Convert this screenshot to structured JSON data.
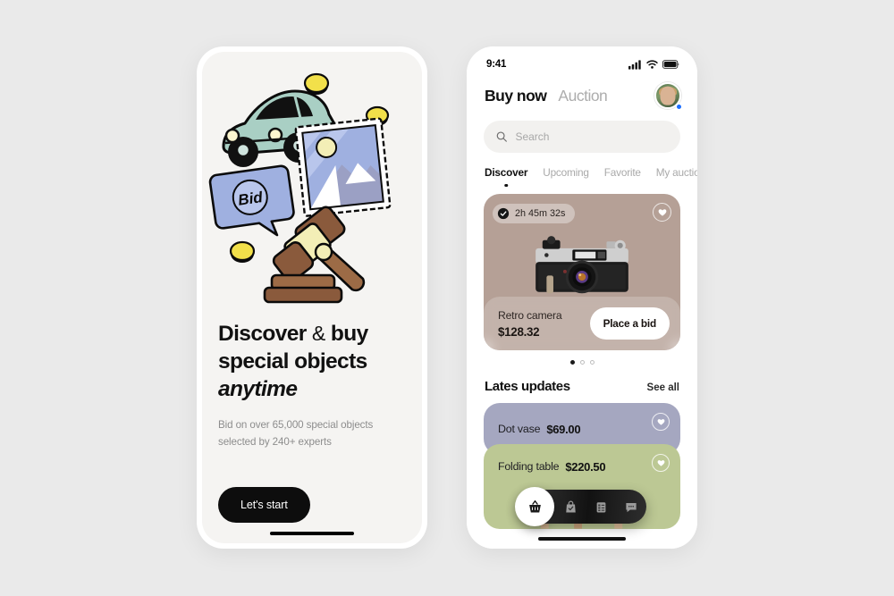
{
  "canvas": {
    "background": "#eaeaea"
  },
  "onboarding": {
    "title_line1_a": "Discover",
    "title_amp": "&",
    "title_line1_b": "buy",
    "title_line2": "special objects",
    "title_line3_italic": "anytime",
    "subtitle": "Bid on over 65,000 special objects selected by 240+ experts",
    "cta_label": "Let's start",
    "illustration_items": [
      "vintage-car",
      "gold-coin",
      "bid-speech-bubble",
      "postage-stamp",
      "auction-gavel"
    ]
  },
  "app": {
    "statusbar": {
      "time": "9:41",
      "icons": [
        "cellular-signal-icon",
        "wifi-icon",
        "battery-icon"
      ]
    },
    "header": {
      "tab_active": "Buy now",
      "tab_inactive": "Auction",
      "avatar_name": "user-avatar",
      "status_dot_color": "#1a6dff"
    },
    "search": {
      "placeholder": "Search",
      "value": "",
      "icon": "search-icon"
    },
    "chips": [
      {
        "label": "Discover",
        "active": true
      },
      {
        "label": "Upcoming",
        "active": false
      },
      {
        "label": "Favorite",
        "active": false
      },
      {
        "label": "My auction",
        "active": false
      }
    ],
    "featured": {
      "timer": "2h 45m 32s",
      "timer_icon": "clock-icon",
      "favorite_icon": "heart-icon",
      "image": "retro-camera",
      "name": "Retro camera",
      "price": "$128.32",
      "bid_label": "Place a bid",
      "background_color": "#b5a096",
      "carousel_dots": 3,
      "carousel_active_index": 0
    },
    "section": {
      "title": "Lates updates",
      "see_all_label": "See all"
    },
    "list_items": [
      {
        "name": "Dot vase",
        "price": "$69.00",
        "color": "#a5a7c0",
        "favorite_icon": "heart-icon"
      },
      {
        "name": "Folding table",
        "price": "$220.50",
        "color": "#bcc894",
        "favorite_icon": "heart-icon"
      }
    ],
    "tabbar": [
      {
        "icon": "basket-icon",
        "active": true
      },
      {
        "icon": "bag-check-icon",
        "active": false
      },
      {
        "icon": "clipboard-list-icon",
        "active": false
      },
      {
        "icon": "chat-bubble-icon",
        "active": false
      }
    ]
  }
}
